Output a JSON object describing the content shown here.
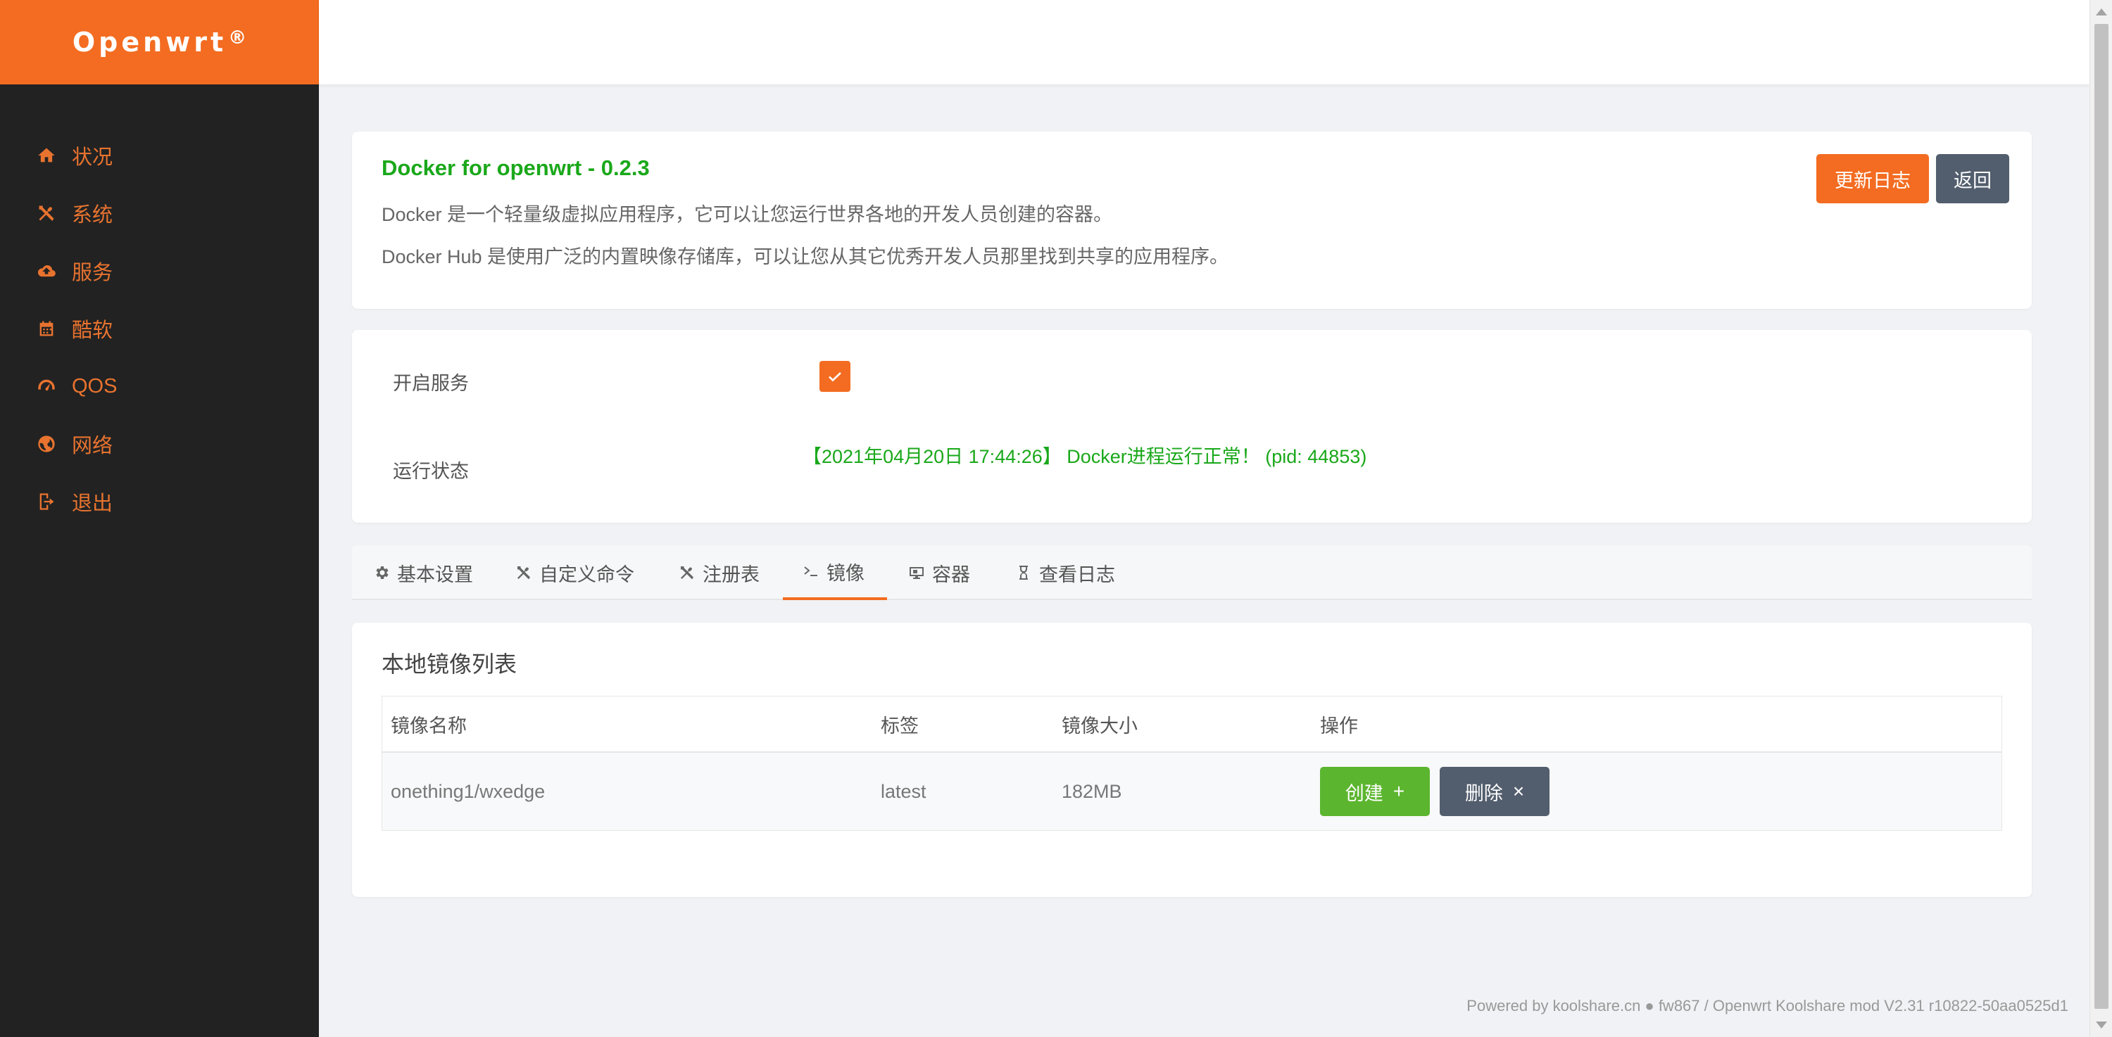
{
  "sidebar": {
    "brand": "Openwrt",
    "brand_mark": "®",
    "items": [
      {
        "label": "状况",
        "icon": "home-icon"
      },
      {
        "label": "系统",
        "icon": "tools-icon"
      },
      {
        "label": "服务",
        "icon": "cloud-upload-icon"
      },
      {
        "label": "酷软",
        "icon": "calendar-icon"
      },
      {
        "label": "QOS",
        "icon": "speedometer-icon"
      },
      {
        "label": "网络",
        "icon": "globe-icon"
      },
      {
        "label": "退出",
        "icon": "logout-icon"
      }
    ]
  },
  "info": {
    "title": "Docker for openwrt - 0.2.3",
    "desc1": "Docker 是一个轻量级虚拟应用程序，它可以让您运行世界各地的开发人员创建的容器。",
    "desc2": "Docker Hub 是使用广泛的内置映像存储库，可以让您从其它优秀开发人员那里找到共享的应用程序。",
    "btn_log": "更新日志",
    "btn_back": "返回"
  },
  "service": {
    "enable_label": "开启服务",
    "enabled": true,
    "status_label": "运行状态",
    "status_text": "【2021年04月20日 17:44:26】 Docker进程运行正常！ (pid: 44853)"
  },
  "tabs": [
    {
      "label": "基本设置",
      "icon": "gear-icon"
    },
    {
      "label": "自定义命令",
      "icon": "tools-icon"
    },
    {
      "label": "注册表",
      "icon": "tools-icon"
    },
    {
      "label": "镜像",
      "icon": "terminal-icon",
      "active": true
    },
    {
      "label": "容器",
      "icon": "monitor-icon"
    },
    {
      "label": "查看日志",
      "icon": "hourglass-icon"
    }
  ],
  "image_list": {
    "title": "本地镜像列表",
    "headers": [
      "镜像名称",
      "标签",
      "镜像大小",
      "操作"
    ],
    "rows": [
      {
        "name": "onething1/wxedge",
        "tag": "latest",
        "size": "182MB",
        "create_label": "创建",
        "create_sym": "+",
        "delete_label": "删除",
        "delete_sym": "×"
      }
    ]
  },
  "footer": "Powered by koolshare.cn ● fw867 / Openwrt Koolshare mod V2.31 r10822-50aa0525d1",
  "colors": {
    "accent": "#f36c21",
    "sidebar_bg": "#222222",
    "success": "#1aa81a",
    "create": "#5cb52f",
    "secondary": "#525e6d"
  }
}
